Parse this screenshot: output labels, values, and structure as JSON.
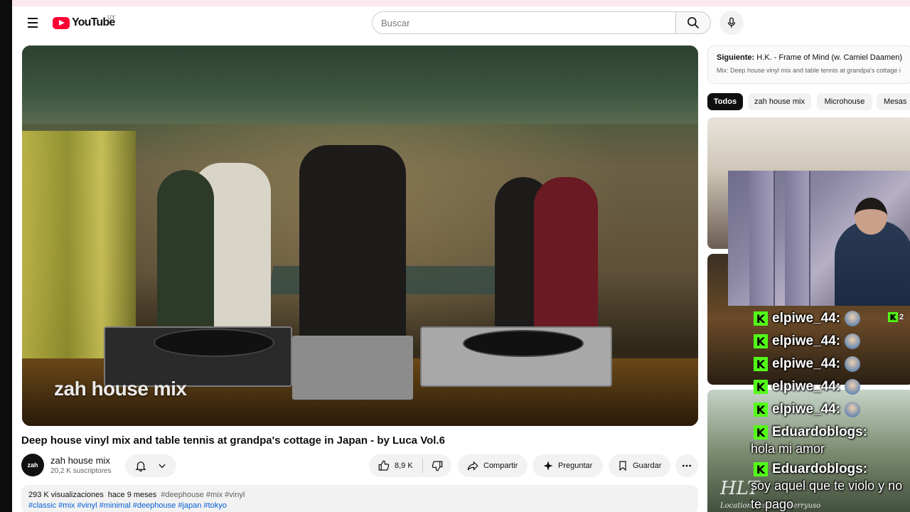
{
  "header": {
    "logo_text": "YouTube",
    "country_code": "UY",
    "search_placeholder": "Buscar"
  },
  "player": {
    "overlay_text": "zah house mix"
  },
  "video": {
    "title": "Deep house vinyl mix and table tennis at grandpa's cottage in Japan - by Luca Vol.6",
    "channel": {
      "avatar_text": "zah",
      "name": "zah house mix",
      "subscribers": "20,2 K suscriptores"
    },
    "actions": {
      "likes": "8,9 K",
      "share": "Compartir",
      "ask": "Preguntar",
      "save": "Guardar"
    },
    "description": {
      "views": "293 K visualizaciones",
      "time": "hace 9 meses",
      "tags_line1": "#deephouse #mix #vinyl",
      "tags_line2": "#classic #mix #vinyl #minimal #deephouse #japan #tokyo"
    }
  },
  "sidebar": {
    "next": {
      "label": "Siguiente:",
      "title": "H.K. - Frame of Mind (w. Camiel Daamen)",
      "playlist": "Mix: Deep house vinyl mix and table tennis at grandpa's cottage i"
    },
    "chips": [
      "Todos",
      "zah house mix",
      "Microhouse",
      "Mesas"
    ],
    "thumb3_text": "HLT",
    "thumb3_sub": "Location Session · Kerryuso"
  },
  "overlay_chat": {
    "badge_count": "2",
    "messages": [
      {
        "user": "elpiwe_44:",
        "text": ""
      },
      {
        "user": "elpiwe_44:",
        "text": ""
      },
      {
        "user": "elpiwe_44:",
        "text": ""
      },
      {
        "user": "elpiwe_44:",
        "text": ""
      },
      {
        "user": "elpiwe_44:",
        "text": ""
      },
      {
        "user": "Eduardoblogs:",
        "text": "hola mi amor"
      },
      {
        "user": "Eduardoblogs:",
        "text": "soy aquel que te violo y no te pago"
      }
    ],
    "kick_color": "#53fc18"
  },
  "colors": {
    "youtube_red": "#ff0033",
    "link_blue": "#065fd4"
  }
}
